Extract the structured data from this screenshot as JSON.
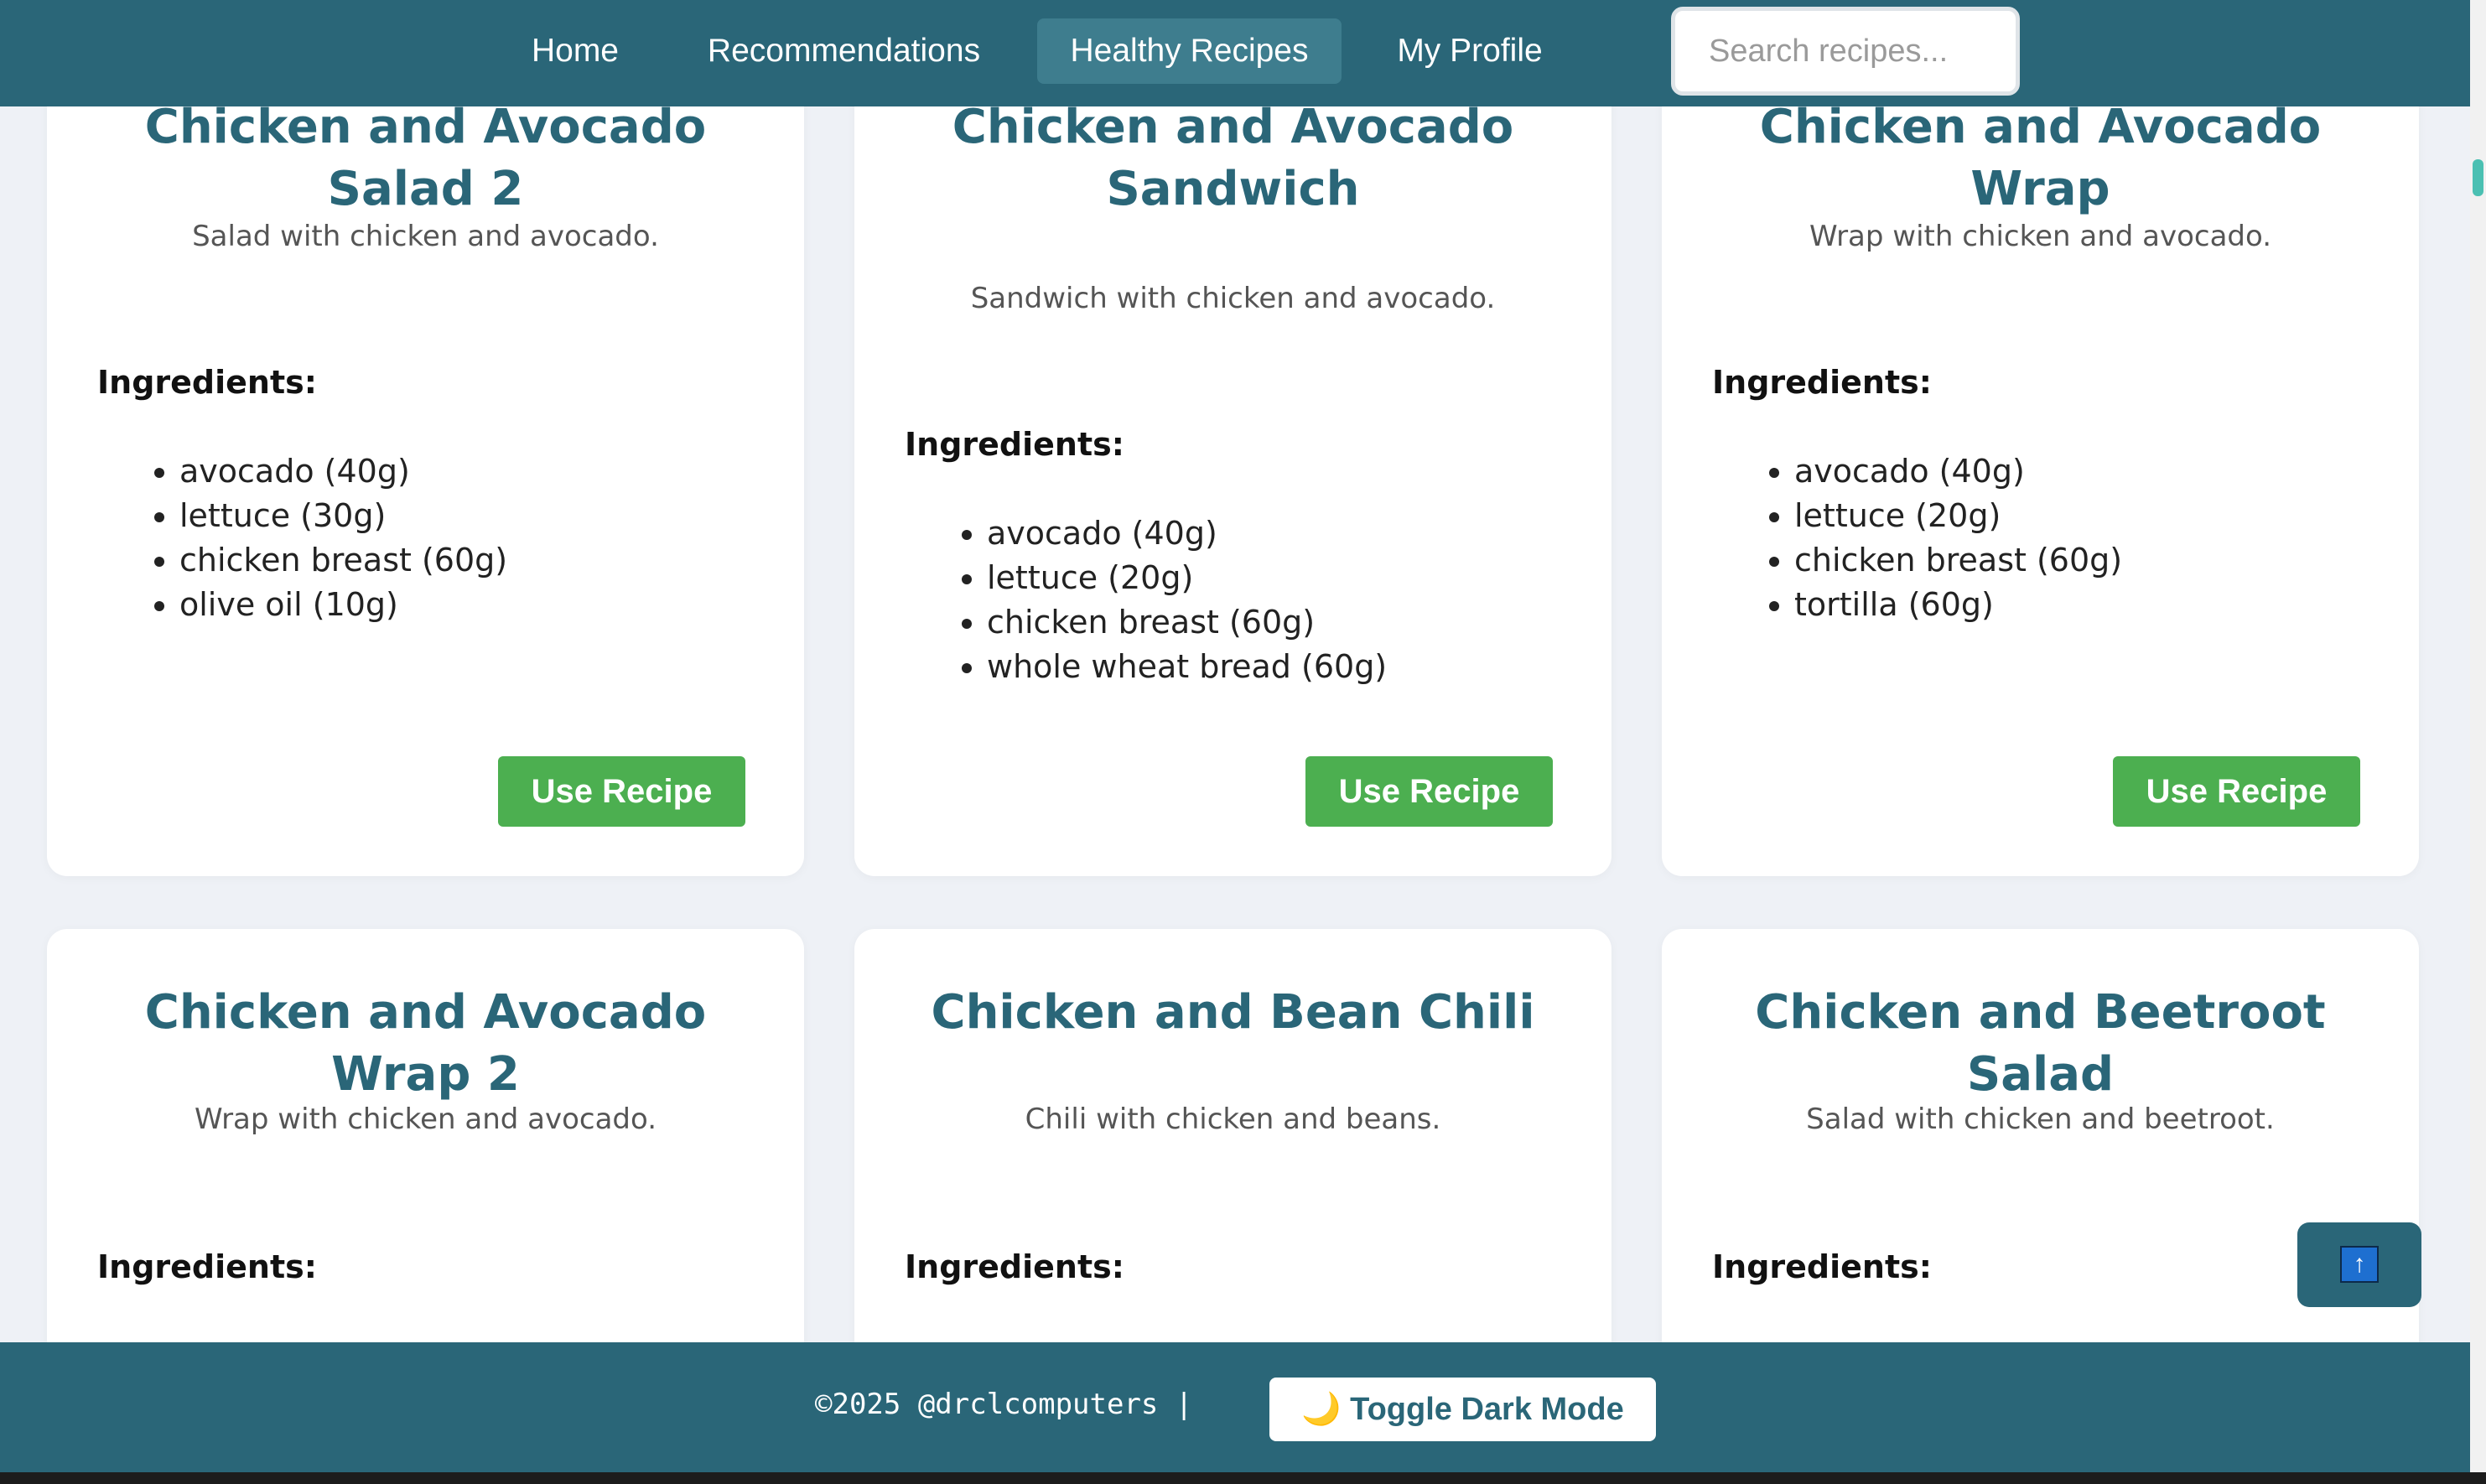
{
  "nav": {
    "links": [
      {
        "label": "Home"
      },
      {
        "label": "Recommendations"
      },
      {
        "label": "Healthy Recipes"
      },
      {
        "label": "My Profile"
      }
    ],
    "search_placeholder": "Search recipes..."
  },
  "recipes": [
    {
      "title": "Chicken and Avocado Salad 2",
      "description": "Salad with chicken and avocado.",
      "ingredients_heading": "Ingredients:",
      "ingredients": [
        "avocado (40g)",
        "lettuce (30g)",
        "chicken breast (60g)",
        "olive oil (10g)"
      ],
      "button": "Use Recipe"
    },
    {
      "title": "Chicken and Avocado Sandwich",
      "description": "Sandwich with chicken and avocado.",
      "ingredients_heading": "Ingredients:",
      "ingredients": [
        "avocado (40g)",
        "lettuce (20g)",
        "chicken breast (60g)",
        "whole wheat bread (60g)"
      ],
      "button": "Use Recipe"
    },
    {
      "title": "Chicken and Avocado Wrap",
      "description": "Wrap with chicken and avocado.",
      "ingredients_heading": "Ingredients:",
      "ingredients": [
        "avocado (40g)",
        "lettuce (20g)",
        "chicken breast (60g)",
        "tortilla (60g)"
      ],
      "button": "Use Recipe"
    },
    {
      "title": "Chicken and Avocado Wrap 2",
      "description": "Wrap with chicken and avocado.",
      "ingredients_heading": "Ingredients:"
    },
    {
      "title": "Chicken and Bean Chili",
      "description": "Chili with chicken and beans.",
      "ingredients_heading": "Ingredients:"
    },
    {
      "title": "Chicken and Beetroot Salad",
      "description": "Salad with chicken and beetroot.",
      "ingredients_heading": "Ingredients:"
    }
  ],
  "scroll_top": {
    "icon": "arrow-up-icon",
    "glyph": "↑"
  },
  "footer": {
    "copyright": "©2025 @drclcomputers |",
    "toggle_icon": "moon-icon",
    "toggle_glyph": "🌙",
    "toggle_label": "Toggle Dark Mode"
  },
  "colors": {
    "primary": "#2a6678",
    "accent_green": "#4caf50",
    "background": "#eef1f6"
  }
}
